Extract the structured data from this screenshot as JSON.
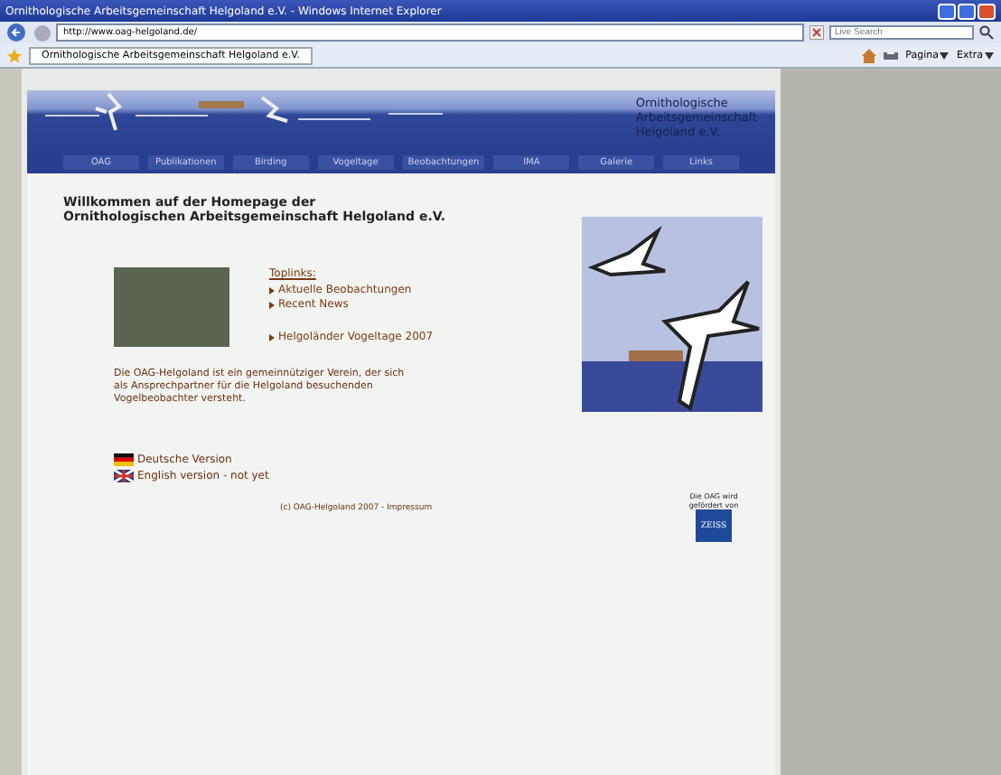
{
  "window": {
    "title": "Ornithologische Arbeitsgemeinschaft Helgoland e.V. - Windows Internet Explorer"
  },
  "address_bar": {
    "value": "http://www.oag-helgoland.de/"
  },
  "search": {
    "placeholder": "Live Search"
  },
  "tabs": [
    {
      "label": "Ornithologische Arbeitsgemeinschaft Helgoland e.V.",
      "selected": true
    }
  ],
  "toolbar": [
    "Pagina",
    "Extra"
  ],
  "site": {
    "title_lines": [
      "Ornithologische",
      "Arbeitsgemeinschaft",
      "Helgoland e.V."
    ],
    "nav": [
      "OAG",
      "Publikationen",
      "Birding",
      "Vogeltage",
      "Beobachtungen",
      "IMA",
      "Galerie",
      "Links"
    ],
    "heading_lines": [
      "Willkommen auf der Homepage der",
      "Ornithologischen Arbeitsgemeinschaft Helgoland e.V."
    ],
    "toplinks_heading": "Toplinks:",
    "toplink_groups": [
      [
        "Aktuelle Beobachtungen",
        "Recent News"
      ],
      [
        "Helgoländer Vogeltage 2007"
      ]
    ],
    "intro": "Die OAG-Helgoland ist ein gemeinnütziger Verein, der sich als Ansprechpartner für die Helgoland besuchenden Vogelbeobachter versteht.",
    "languages": [
      {
        "kind": "de",
        "label": "Deutsche Version"
      },
      {
        "kind": "en",
        "label": "English version - not yet"
      }
    ],
    "sponsor_text": "Die OAG wird gefördert von",
    "sponsor_logo": "ZEISS",
    "footer": "(c) OAG-Helgoland 2007 - Impressum"
  }
}
